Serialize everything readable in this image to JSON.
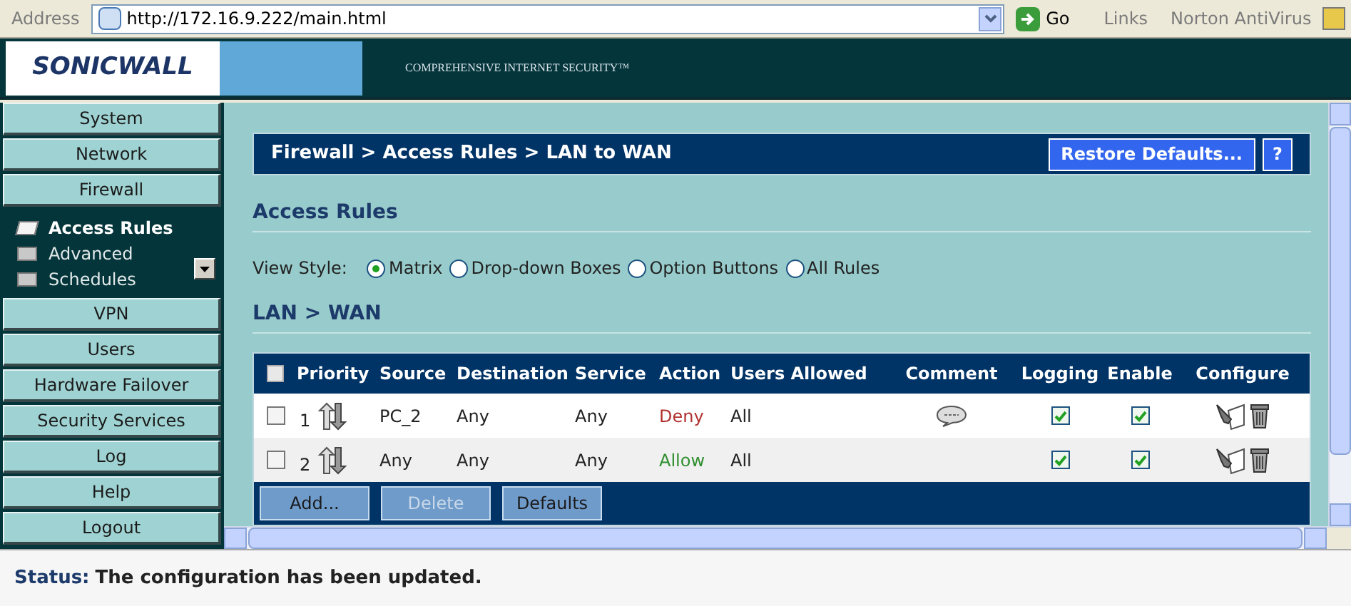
{
  "address_bar": {
    "label": "Address",
    "url": "http://172.16.9.222/main.html",
    "go": "Go",
    "links": "Links",
    "toolbar": "Norton AntiVirus"
  },
  "header": {
    "logo": "SONICWALL",
    "tagline": "COMPREHENSIVE INTERNET SECURITY™"
  },
  "sidebar": {
    "items_before": [
      {
        "label": "System"
      },
      {
        "label": "Network"
      },
      {
        "label": "Firewall"
      }
    ],
    "submenu": [
      {
        "label": "Access Rules",
        "selected": true
      },
      {
        "label": "Advanced",
        "selected": false
      },
      {
        "label": "Schedules",
        "selected": false
      }
    ],
    "items_after": [
      {
        "label": "VPN"
      },
      {
        "label": "Users"
      },
      {
        "label": "Hardware Failover"
      },
      {
        "label": "Security Services"
      },
      {
        "label": "Log"
      },
      {
        "label": "Help"
      },
      {
        "label": "Logout"
      }
    ]
  },
  "title_bar": {
    "breadcrumb": "Firewall > Access Rules > LAN to WAN",
    "restore_button": "Restore Defaults...",
    "help_button": "?"
  },
  "section_title": "Access Rules",
  "view_style": {
    "label": "View Style:",
    "options": [
      {
        "label": "Matrix",
        "selected": true
      },
      {
        "label": "Drop-down Boxes",
        "selected": false
      },
      {
        "label": "Option Buttons",
        "selected": false
      },
      {
        "label": "All Rules",
        "selected": false
      }
    ]
  },
  "table_title": "LAN > WAN",
  "table": {
    "select_all_checked": false,
    "columns": [
      "Priority",
      "Source",
      "Destination",
      "Service",
      "Action",
      "Users Allowed",
      "Comment",
      "Logging",
      "Enable",
      "Configure"
    ],
    "rows": [
      {
        "priority": "1",
        "source": "PC_2",
        "destination": "Any",
        "service": "Any",
        "action": "Deny",
        "color": "#b03030",
        "users": "All",
        "has_comment": true,
        "logging": true,
        "enable": true,
        "selected": false
      },
      {
        "priority": "2",
        "source": "Any",
        "destination": "Any",
        "service": "Any",
        "action": "Allow",
        "color": "#2f8f2f",
        "users": "All",
        "has_comment": false,
        "logging": true,
        "enable": true,
        "selected": false
      }
    ],
    "buttons": [
      {
        "label": "Add...",
        "disabled": false
      },
      {
        "label": "Delete",
        "disabled": true
      },
      {
        "label": "Defaults",
        "disabled": false
      }
    ]
  },
  "status_bar": {
    "label": "Status:",
    "message": "The configuration has been updated."
  }
}
